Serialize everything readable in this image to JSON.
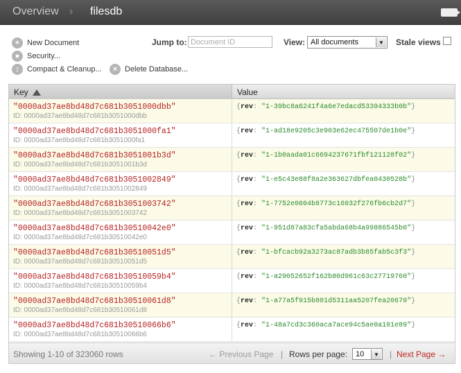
{
  "header": {
    "breadcrumb_root": "Overview",
    "breadcrumb_separator": "›",
    "database": "filesdb",
    "toggle_icon": "sidebar-toggle-icon"
  },
  "toolbar": {
    "new_document": "New Document",
    "security": "Security...",
    "compact_cleanup": "Compact & Cleanup...",
    "delete_database": "Delete Database...",
    "jump_to_label": "Jump to:",
    "jump_to_placeholder": "Document ID",
    "view_label": "View:",
    "view_selected": "All documents",
    "stale_views_label": "Stale views",
    "stale_views_checked": false
  },
  "table": {
    "columns": [
      "Key",
      "Value"
    ],
    "sort_column": "Key",
    "sort_direction": "ascending",
    "value_prop": "rev",
    "rows": [
      {
        "key": "\"0000ad37ae8bd48d7c681b3051000dbb\"",
        "id": "ID: 0000ad37ae8bd48d7c681b3051000dbb",
        "rev": "\"1-39bc8a6241f4a6e7edacd53394333b0b\""
      },
      {
        "key": "\"0000ad37ae8bd48d7c681b3051000fa1\"",
        "id": "ID: 0000ad37ae8bd48d7c681b3051000fa1",
        "rev": "\"1-ad18e9205c3e903e62ec475507de1b0e\""
      },
      {
        "key": "\"0000ad37ae8bd48d7c681b3051001b3d\"",
        "id": "ID: 0000ad37ae8bd48d7c681b3051001b3d",
        "rev": "\"1-1b0aada01c6694237671fbf121128f02\""
      },
      {
        "key": "\"0000ad37ae8bd48d7c681b3051002849\"",
        "id": "ID: 0000ad37ae8bd48d7c681b3051002849",
        "rev": "\"1-e5c43e88f8a2e363627dbfea0430528b\""
      },
      {
        "key": "\"0000ad37ae8bd48d7c681b3051003742\"",
        "id": "ID: 0000ad37ae8bd48d7c681b3051003742",
        "rev": "\"1-7752e0604b8773c16032f276fb6cb2d7\""
      },
      {
        "key": "\"0000ad37ae8bd48d7c681b30510042e0\"",
        "id": "ID: 0000ad37ae8bd48d7c681b30510042e0",
        "rev": "\"1-951d87a83cfa5abda68b4a99886545b0\""
      },
      {
        "key": "\"0000ad37ae8bd48d7c681b30510051d5\"",
        "id": "ID: 0000ad37ae8bd48d7c681b30510051d5",
        "rev": "\"1-bfcacb92a3273ac87adb3b85fab5c3f3\""
      },
      {
        "key": "\"0000ad37ae8bd48d7c681b30510059b4\"",
        "id": "ID: 0000ad37ae8bd48d7c681b30510059b4",
        "rev": "\"1-a29052652f162b80d961c63c27719760\""
      },
      {
        "key": "\"0000ad37ae8bd48d7c681b30510061d8\"",
        "id": "ID: 0000ad37ae8bd48d7c681b30510061d8",
        "rev": "\"1-a77a5f915b801d5311aa5207fea20679\""
      },
      {
        "key": "\"0000ad37ae8bd48d7c681b30510066b6\"",
        "id": "ID: 0000ad37ae8bd48d7c681b30510066b6",
        "rev": "\"1-48a7cd3c360aca7ace94c5ae0a101e89\""
      }
    ]
  },
  "pagination": {
    "summary": "Showing 1-10 of 323060 rows",
    "previous": "← Previous Page",
    "separator": "|",
    "per_page_label": "Rows per page:",
    "per_page_value": "10",
    "next": "Next Page →"
  },
  "colors": {
    "header_bg": "#474747",
    "key_text": "#b62020",
    "rev_text": "#2a8a2a",
    "odd_row_bg": "#fbfbe8",
    "next_link": "#c0271f"
  }
}
